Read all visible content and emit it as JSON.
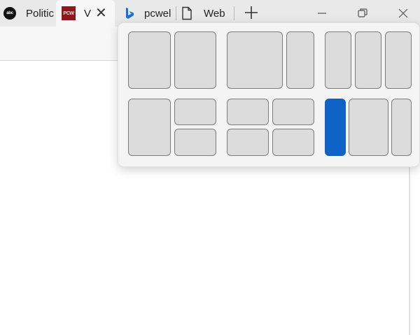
{
  "tabs": [
    {
      "label": "Politic",
      "favicon": "abc-news-icon",
      "favicon_text": "abc"
    },
    {
      "label": "V",
      "favicon": "pcworld-icon",
      "favicon_text": "PCW",
      "active": true
    },
    {
      "label": "pcwel",
      "favicon": "bing-icon"
    },
    {
      "label": "Web",
      "favicon": "page-icon"
    }
  ],
  "new_tab": "plus-icon",
  "window_controls": [
    "minimize-icon",
    "restore-icon",
    "close-icon"
  ],
  "snap_layouts": [
    {
      "name": "two-equal",
      "zones": 2
    },
    {
      "name": "wide-left-narrow-right",
      "zones": 2
    },
    {
      "name": "three-columns",
      "zones": 3
    },
    {
      "name": "left-plus-two-stacked",
      "zones": 3
    },
    {
      "name": "quadrants",
      "zones": 4
    },
    {
      "name": "narrow-wide-narrow",
      "zones": 3,
      "selected_zone": 1
    }
  ],
  "colors": {
    "accent": "#0f62c6",
    "zone": "#dcdcdc",
    "tabbar": "#e9e9e9",
    "pcw_brand": "#8b1a1a"
  }
}
